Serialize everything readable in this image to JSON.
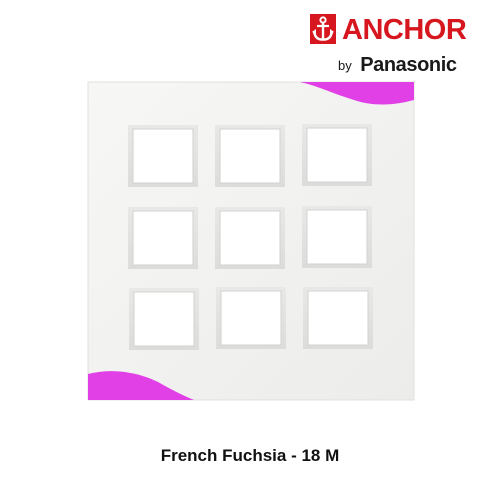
{
  "brand": {
    "name": "ANCHOR",
    "by": "by",
    "parent": "Panasonic",
    "icon": "anchor-icon",
    "color": "#d7171f"
  },
  "product": {
    "caption": "French Fuchsia - 18 M",
    "plate_color": "#f3f3f1",
    "accent_color": "#e040e6",
    "openings": 9
  }
}
